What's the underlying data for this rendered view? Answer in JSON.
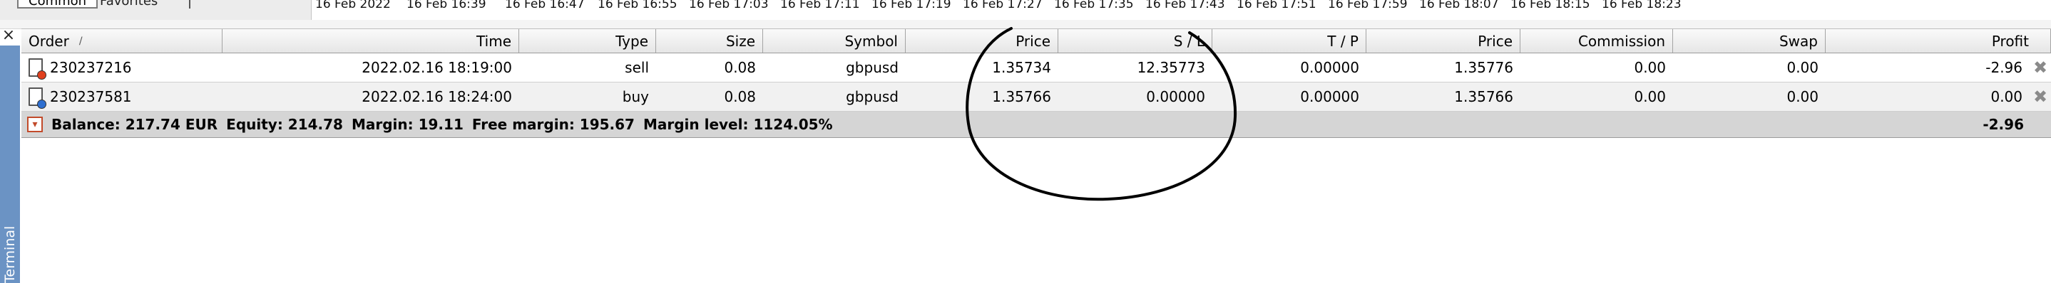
{
  "tabs": {
    "common": "Common",
    "favorites": "Favorites"
  },
  "time_axis": [
    "16 Feb 2022",
    "16 Feb 16:39",
    "16 Feb 16:47",
    "16 Feb 16:55",
    "16 Feb 17:03",
    "16 Feb 17:11",
    "16 Feb 17:19",
    "16 Feb 17:27",
    "16 Feb 17:35",
    "16 Feb 17:43",
    "16 Feb 17:51",
    "16 Feb 17:59",
    "16 Feb 18:07",
    "16 Feb 18:15",
    "16 Feb 18:23"
  ],
  "terminal": {
    "close_glyph": "×",
    "side_label": "Terminal"
  },
  "table": {
    "columns": {
      "order": "Order",
      "time": "Time",
      "type": "Type",
      "size": "Size",
      "symbol": "Symbol",
      "price": "Price",
      "sl": "S / L",
      "tp": "T / P",
      "price2": "Price",
      "commission": "Commission",
      "swap": "Swap",
      "profit": "Profit"
    },
    "sort_arrow": "/",
    "rows": [
      {
        "order": "230237216",
        "time": "2022.02.16 18:19:00",
        "type": "sell",
        "size": "0.08",
        "symbol": "gbpusd",
        "price": "1.35734",
        "sl": "12.35773",
        "tp": "0.00000",
        "price2": "1.35776",
        "commission": "0.00",
        "swap": "0.00",
        "profit": "-2.96",
        "dot_color": "#e0401e",
        "close_glyph": "✖"
      },
      {
        "order": "230237581",
        "time": "2022.02.16 18:24:00",
        "type": "buy",
        "size": "0.08",
        "symbol": "gbpusd",
        "price": "1.35766",
        "sl": "0.00000",
        "tp": "0.00000",
        "price2": "1.35766",
        "commission": "0.00",
        "swap": "0.00",
        "profit": "0.00",
        "dot_color": "#2e6fd0",
        "close_glyph": "✖"
      }
    ],
    "summary": {
      "icon_glyph": "▾",
      "balance": "Balance: 217.74 EUR",
      "equity": "Equity: 214.78",
      "margin": "Margin: 19.11",
      "free_margin": "Free margin: 195.67",
      "margin_level": "Margin level: 1124.05%",
      "profit": "-2.96"
    }
  },
  "colors": {
    "annotation_ellipse": "#000000",
    "side_bar": "#6b93c4"
  }
}
